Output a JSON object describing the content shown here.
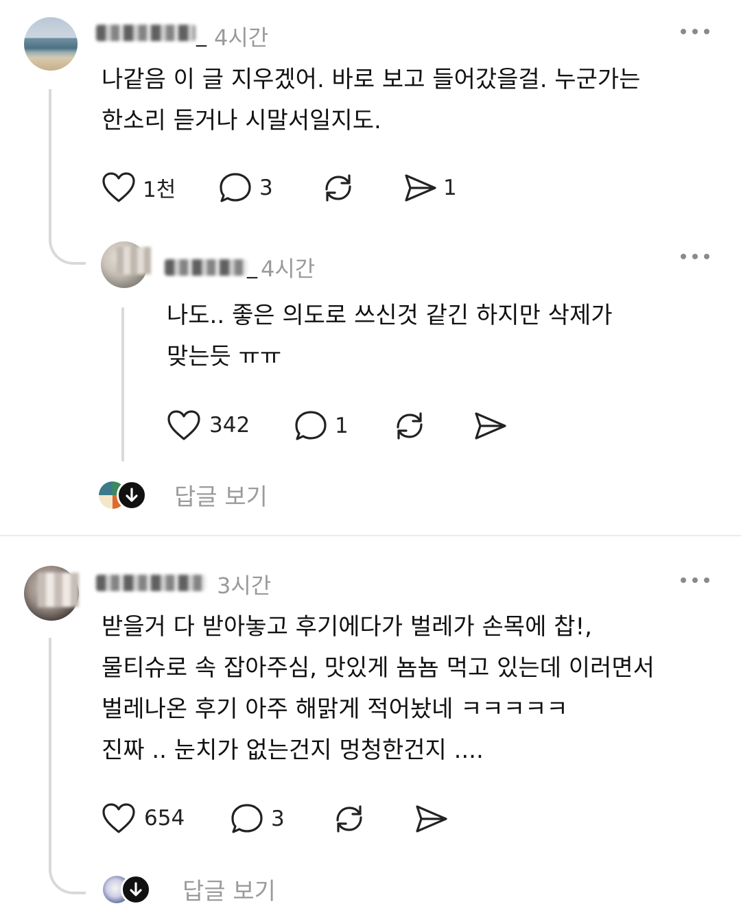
{
  "comments": [
    {
      "username_suffix": "_",
      "time": "4시간",
      "text": "나같음 이 글 지우겠어. 바로 보고 들어갔을걸. 누군가는\n한소리 듣거나 시말서일지도.",
      "likes": "1천",
      "comments": "3",
      "shares": "1",
      "replies": [
        {
          "username_suffix": "_",
          "time": "4시간",
          "text": "나도.. 좋은 의도로 쓰신것 같긴 하지만 삭제가\n맞는듯 ㅠㅠ",
          "likes": "342",
          "comments": "1"
        }
      ],
      "view_replies": "답글 보기"
    },
    {
      "username_suffix": "",
      "time": "3시간",
      "text": "받을거 다 받아놓고 후기에다가 벌레가 손목에 찹!,\n물티슈로 속 잡아주심, 맛있게 뇸뇸 먹고 있는데 이러면서\n벌레나온 후기 아주 해맑게 적어놨네 ㅋㅋㅋㅋㅋ\n진짜 .. 눈치가 없는건지 멍청한건지 ....",
      "likes": "654",
      "comments": "3",
      "view_replies": "답글 보기"
    }
  ],
  "icons": [
    "heart-icon",
    "comment-icon",
    "repost-icon",
    "share-icon",
    "more-icon",
    "arrow-down-icon"
  ],
  "colors": {
    "text": "#111111",
    "muted": "#9a9a9a",
    "line": "#d9d9d9"
  }
}
